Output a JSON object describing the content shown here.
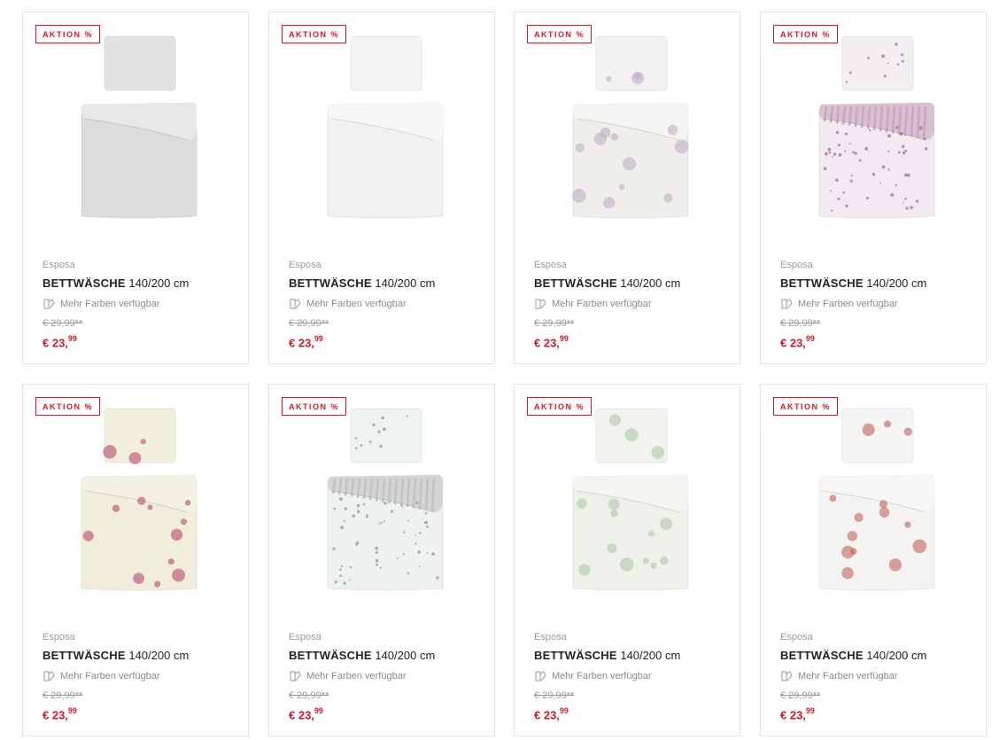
{
  "colors": {
    "accent": "#d3172b",
    "border": "#e3e3e3"
  },
  "products": [
    {
      "badge": "AKTION %",
      "brand": "Esposa",
      "name": "BETTWÄSCHE",
      "size": "140/200 cm",
      "colors_label": "Mehr Farben verfügbar",
      "old_price": "€ 29,99**",
      "price_main": "€ 23,",
      "price_cents": "99",
      "pattern": "grey-plain"
    },
    {
      "badge": "AKTION %",
      "brand": "Esposa",
      "name": "BETTWÄSCHE",
      "size": "140/200 cm",
      "colors_label": "Mehr Farben verfügbar",
      "old_price": "€ 29,99**",
      "price_main": "€ 23,",
      "price_cents": "99",
      "pattern": "white-plain"
    },
    {
      "badge": "AKTION %",
      "brand": "Esposa",
      "name": "BETTWÄSCHE",
      "size": "140/200 cm",
      "colors_label": "Mehr Farben verfügbar",
      "old_price": "€ 29,99**",
      "price_main": "€ 23,",
      "price_cents": "99",
      "pattern": "lilac-ginkgo"
    },
    {
      "badge": "AKTION %",
      "brand": "Esposa",
      "name": "BETTWÄSCHE",
      "size": "140/200 cm",
      "colors_label": "Mehr Farben verfügbar",
      "old_price": "€ 29,99**",
      "price_main": "€ 23,",
      "price_cents": "99",
      "pattern": "mauve-stripes"
    },
    {
      "badge": "AKTION %",
      "brand": "Esposa",
      "name": "BETTWÄSCHE",
      "size": "140/200 cm",
      "colors_label": "Mehr Farben verfügbar",
      "old_price": "€ 29,99**",
      "price_main": "€ 23,",
      "price_cents": "99",
      "pattern": "cream-roses"
    },
    {
      "badge": "AKTION %",
      "brand": "Esposa",
      "name": "BETTWÄSCHE",
      "size": "140/200 cm",
      "colors_label": "Mehr Farben verfügbar",
      "old_price": "€ 29,99**",
      "price_main": "€ 23,",
      "price_cents": "99",
      "pattern": "grey-stripes"
    },
    {
      "badge": "AKTION %",
      "brand": "Esposa",
      "name": "BETTWÄSCHE",
      "size": "140/200 cm",
      "colors_label": "Mehr Farben verfügbar",
      "old_price": "€ 29,99**",
      "price_main": "€ 23,",
      "price_cents": "99",
      "pattern": "green-ginkgo"
    },
    {
      "badge": "AKTION %",
      "brand": "Esposa",
      "name": "BETTWÄSCHE",
      "size": "140/200 cm",
      "colors_label": "Mehr Farben verfügbar",
      "old_price": "€ 29,99**",
      "price_main": "€ 23,",
      "price_cents": "99",
      "pattern": "white-roses"
    }
  ]
}
